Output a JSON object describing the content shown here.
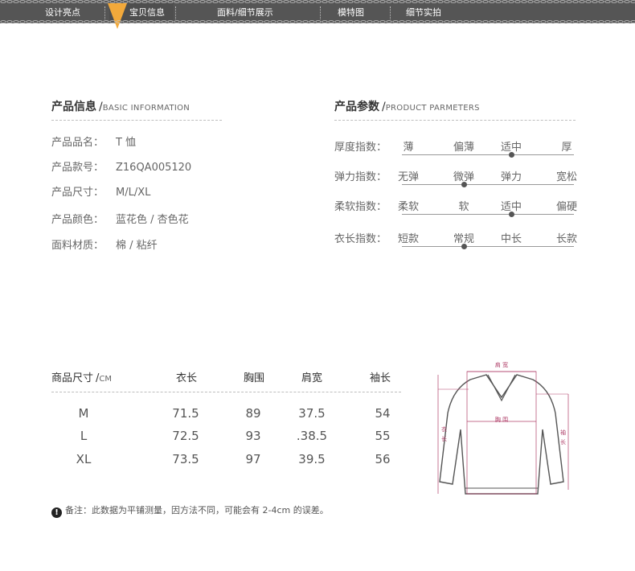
{
  "nav": {
    "items": [
      "设计亮点",
      "宝贝信息",
      "面料/细节展示",
      "模特图",
      "细节实拍"
    ],
    "active": "宝贝信息",
    "accent": "#f2a93b"
  },
  "info": {
    "title_cn": "产品信息",
    "title_en": "BASIC INFORMATION",
    "rows": [
      {
        "label": "产品品名：",
        "value": "T 恤"
      },
      {
        "label": "产品款号：",
        "value": "Z16QA005120"
      },
      {
        "label": "产品尺寸：",
        "value": "M/L/XL"
      },
      {
        "label": "产品颜色：",
        "value": "蓝花色 / 杏色花"
      },
      {
        "label": "面料材质：",
        "value": "棉 / 粘纤"
      }
    ]
  },
  "params": {
    "title_cn": "产品参数",
    "title_en": "PRODUCT PARMETERS",
    "rows": [
      {
        "label": "厚度指数：",
        "options": [
          "薄",
          "偏薄",
          "适中",
          "厚"
        ],
        "selected": 2
      },
      {
        "label": "弹力指数：",
        "options": [
          "无弹",
          "微弹",
          "弹力",
          "宽松"
        ],
        "selected": 1
      },
      {
        "label": "柔软指数：",
        "options": [
          "柔软",
          "软",
          "适中",
          "偏硬"
        ],
        "selected": 2
      },
      {
        "label": "衣长指数：",
        "options": [
          "短款",
          "常规",
          "中长",
          "长款"
        ],
        "selected": 1
      }
    ]
  },
  "size_table": {
    "title_cn": "商品尺寸",
    "unit": "CM",
    "headers": [
      "衣长",
      "胸围",
      "肩宽",
      "袖长"
    ],
    "rows": [
      {
        "size": "M",
        "values": [
          "71.5",
          "89",
          "37.5",
          "54"
        ]
      },
      {
        "size": "L",
        "values": [
          "72.5",
          "93",
          ".38.5",
          "55"
        ]
      },
      {
        "size": "XL",
        "values": [
          "73.5",
          "97",
          "39.5",
          "56"
        ]
      }
    ]
  },
  "diagram": {
    "shoulder": "肩 宽",
    "chest": "胸 围",
    "length": "衣长",
    "sleeve": "袖长",
    "line_color": "#b0406a"
  },
  "note": {
    "icon": "!",
    "text": "备注：此数据为平铺测量，因方法不同，可能会有 2-4cm 的误差。"
  }
}
